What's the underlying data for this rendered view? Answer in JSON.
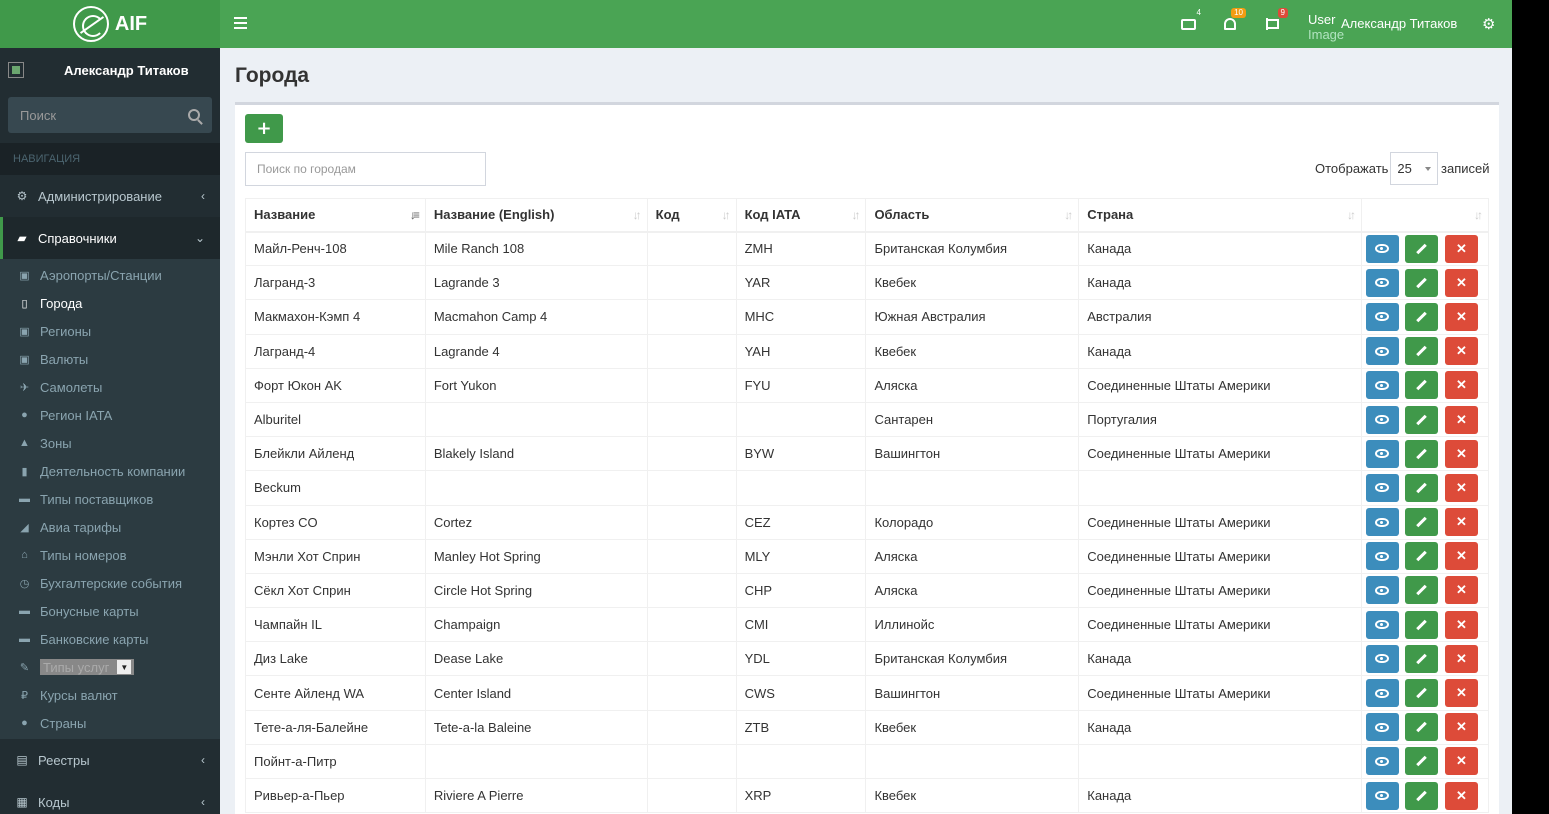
{
  "logo": {
    "text": "AIF"
  },
  "sidebar": {
    "user_name": "Александр Титаков",
    "search_placeholder": "Поиск",
    "nav_header": "НАВИГАЦИЯ",
    "sections": [
      {
        "label": "Администрирование",
        "icon": "gear-icon"
      },
      {
        "label": "Справочники",
        "icon": "book-icon"
      }
    ],
    "sub_items": [
      {
        "label": "Аэропорты/Станции",
        "icon": "image-icon",
        "glyph": "▣"
      },
      {
        "label": "Города",
        "icon": "book-icon",
        "glyph": "▯"
      },
      {
        "label": "Регионы",
        "icon": "image-icon",
        "glyph": "▣"
      },
      {
        "label": "Валюты",
        "icon": "money-icon",
        "glyph": "▣"
      },
      {
        "label": "Самолеты",
        "icon": "plane-icon",
        "glyph": "✈"
      },
      {
        "label": "Регион IATA",
        "icon": "globe-icon",
        "glyph": "●"
      },
      {
        "label": "Зоны",
        "icon": "area-chart-icon",
        "glyph": "▲"
      },
      {
        "label": "Деятельность компании",
        "icon": "building-icon",
        "glyph": "▮"
      },
      {
        "label": "Типы поставщиков",
        "icon": "truck-icon",
        "glyph": "▬"
      },
      {
        "label": "Авиа тарифы",
        "icon": "paper-plane-icon",
        "glyph": "◢"
      },
      {
        "label": "Типы номеров",
        "icon": "home-icon",
        "glyph": "⌂"
      },
      {
        "label": "Бухгалтерские события",
        "icon": "clock-icon",
        "glyph": "◷"
      },
      {
        "label": "Бонусные карты",
        "icon": "credit-card-icon",
        "glyph": "▬"
      },
      {
        "label": "Банковские карты",
        "icon": "credit-card-icon",
        "glyph": "▬"
      },
      {
        "label": "Типы услуг",
        "icon": "wrench-icon",
        "glyph": "✎"
      },
      {
        "label": "Курсы валют",
        "icon": "ruble-icon",
        "glyph": "₽"
      },
      {
        "label": "Страны",
        "icon": "globe-icon",
        "glyph": "●"
      }
    ],
    "bottom_sections": [
      {
        "label": "Реестры",
        "icon": "table-icon"
      },
      {
        "label": "Коды",
        "icon": "grid-icon"
      }
    ]
  },
  "header": {
    "mail_count": "4",
    "notif_count": "10",
    "flag_count": "9",
    "user_image_alt_1": "User",
    "user_image_alt_2": "Image",
    "user_name": "Александр Титаков",
    "colors": {
      "mail_badge": "#40994a",
      "notif_badge": "#f39c12",
      "flag_badge": "#dd4b39"
    }
  },
  "page": {
    "title": "Города",
    "add_label": "+",
    "search_placeholder": "Поиск по городам",
    "show_label": "Отображать",
    "page_size": "25",
    "records_label": "записей"
  },
  "table": {
    "columns": [
      "Название",
      "Название (English)",
      "Код",
      "Код IATA",
      "Область",
      "Страна"
    ],
    "rows": [
      [
        "Майл-Ренч-108",
        "Mile Ranch 108",
        "",
        "ZMH",
        "Британская Колумбия",
        "Канада"
      ],
      [
        "Лагранд-3",
        "Lagrande 3",
        "",
        "YAR",
        "Квебек",
        "Канада"
      ],
      [
        "Макмахон-Кэмп 4",
        "Macmahon Camp 4",
        "",
        "MHC",
        "Южная Австралия",
        "Австралия"
      ],
      [
        "Лагранд-4",
        "Lagrande 4",
        "",
        "YAH",
        "Квебек",
        "Канада"
      ],
      [
        "Форт Юкон AK",
        "Fort Yukon",
        "",
        "FYU",
        "Аляска",
        "Соединенные Штаты Америки"
      ],
      [
        "Alburitel",
        "",
        "",
        "",
        "Сантарен",
        "Португалия"
      ],
      [
        "Блейкли Айленд",
        "Blakely Island",
        "",
        "BYW",
        "Вашингтон",
        "Соединенные Штаты Америки"
      ],
      [
        "Beckum",
        "",
        "",
        "",
        "",
        ""
      ],
      [
        "Кортез CO",
        "Cortez",
        "",
        "CEZ",
        "Колорадо",
        "Соединенные Штаты Америки"
      ],
      [
        "Мэнли Хот Сприн",
        "Manley Hot Spring",
        "",
        "MLY",
        "Аляска",
        "Соединенные Штаты Америки"
      ],
      [
        "Сёкл Хот Сприн",
        "Circle Hot Spring",
        "",
        "CHP",
        "Аляска",
        "Соединенные Штаты Америки"
      ],
      [
        "Чампайн IL",
        "Champaign",
        "",
        "CMI",
        "Иллинойс",
        "Соединенные Штаты Америки"
      ],
      [
        "Диз Lake",
        "Dease Lake",
        "",
        "YDL",
        "Британская Колумбия",
        "Канада"
      ],
      [
        "Сенте Айленд WA",
        "Center Island",
        "",
        "CWS",
        "Вашингтон",
        "Соединенные Штаты Америки"
      ],
      [
        "Тете-а-ля-Балейне",
        "Tete-a-la Baleine",
        "",
        "ZTB",
        "Квебек",
        "Канада"
      ],
      [
        "Пойнт-а-Питр",
        "",
        "",
        "",
        "",
        ""
      ],
      [
        "Ривьер-а-Пьер",
        "Riviere A Pierre",
        "",
        "XRP",
        "Квебек",
        "Канада"
      ]
    ]
  }
}
